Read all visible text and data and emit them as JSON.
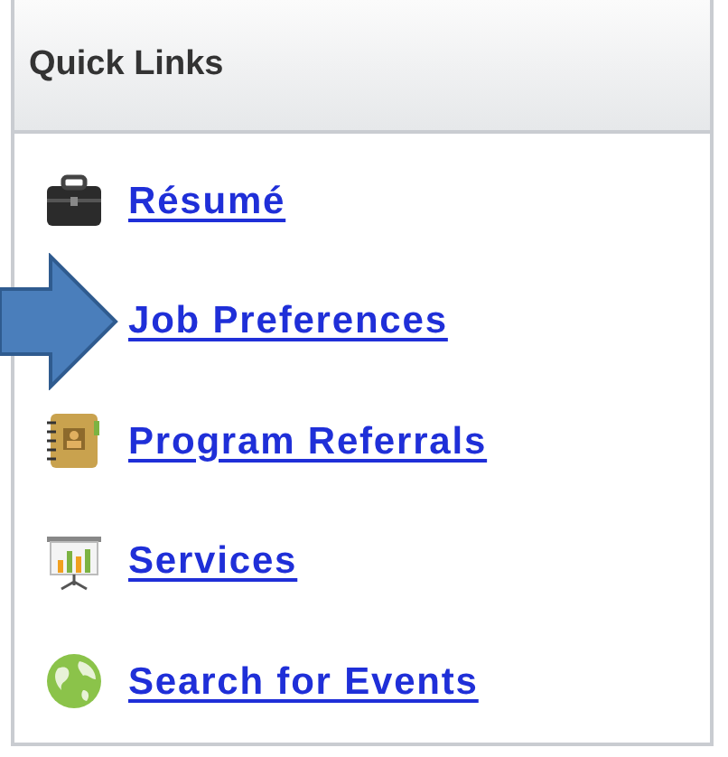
{
  "panel": {
    "title": "Quick Links"
  },
  "links": [
    {
      "label": "Résumé",
      "pointed_at": false
    },
    {
      "label": "Job Preferences",
      "pointed_at": true
    },
    {
      "label": "Program Referrals",
      "pointed_at": false
    },
    {
      "label": "Services",
      "pointed_at": false
    },
    {
      "label": "Search for Events",
      "pointed_at": false
    }
  ]
}
